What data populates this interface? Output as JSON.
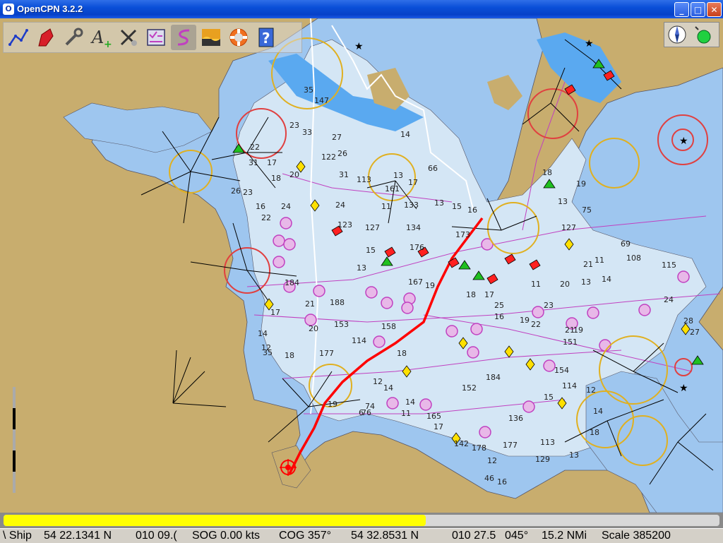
{
  "window": {
    "title": "OpenCPN 3.2.2",
    "icon": "opencpn-app-icon",
    "buttons": {
      "minimize": "_",
      "maximize": "□",
      "close": "✕"
    }
  },
  "toolbar": {
    "items": [
      {
        "name": "route-tool-button",
        "icon": "route-icon"
      },
      {
        "name": "ownship-button",
        "icon": "boat-icon"
      },
      {
        "name": "tools-button",
        "icon": "wrench-icon"
      },
      {
        "name": "text-button",
        "icon": "text-plus-icon"
      },
      {
        "name": "chart-quilt-button",
        "icon": "cross-icon"
      },
      {
        "name": "route-manager-button",
        "icon": "checklist-icon"
      },
      {
        "name": "track-button",
        "icon": "track-icon",
        "active": true
      },
      {
        "name": "tide-button",
        "icon": "tide-icon"
      },
      {
        "name": "mob-button",
        "icon": "lifebuoy-icon"
      },
      {
        "name": "help-button",
        "icon": "help-icon"
      }
    ]
  },
  "progress": {
    "value": 0.59
  },
  "colors": {
    "land": "#c8ad6e",
    "shallow": "#9ec6ef",
    "deep": "#d4e6f5",
    "water": "#5aa9f0",
    "track": "#ff0000",
    "magenta": "#c040c0",
    "progress": "#ffff00"
  },
  "status": {
    "ship_label": "\\ Ship",
    "ship_lat": "54 22.1341 N",
    "ship_lon": "010 09.(",
    "sog": "SOG 0.00 kts",
    "cog": "COG 357°",
    "cursor_lat": "54 32.8531 N",
    "cursor_lon": "010 27.5",
    "cursor_brg": "045°",
    "cursor_dist": "15.2 NMi",
    "scale": "Scale 385200"
  },
  "chart": {
    "soundings": [
      [
        "35",
        430,
        105
      ],
      [
        "147",
        445,
        120
      ],
      [
        "33",
        428,
        165
      ],
      [
        "27",
        470,
        172
      ],
      [
        "26",
        478,
        195
      ],
      [
        "122",
        455,
        200
      ],
      [
        "31",
        480,
        225
      ],
      [
        "113",
        505,
        232
      ],
      [
        "24",
        475,
        268
      ],
      [
        "123",
        478,
        296
      ],
      [
        "127",
        517,
        300
      ],
      [
        "15",
        518,
        332
      ],
      [
        "13",
        505,
        357
      ],
      [
        "176",
        580,
        328
      ],
      [
        "167",
        578,
        377
      ],
      [
        "19",
        602,
        382
      ],
      [
        "173",
        645,
        310
      ],
      [
        "16",
        662,
        275
      ],
      [
        "15",
        640,
        270
      ],
      [
        "13",
        615,
        265
      ],
      [
        "11",
        540,
        270
      ],
      [
        "133",
        572,
        268
      ],
      [
        "134",
        575,
        300
      ],
      [
        "24",
        398,
        270
      ],
      [
        "22",
        370,
        286
      ],
      [
        "184",
        403,
        378
      ],
      [
        "21",
        432,
        408
      ],
      [
        "188",
        467,
        406
      ],
      [
        "20",
        437,
        443
      ],
      [
        "153",
        473,
        437
      ],
      [
        "158",
        540,
        440
      ],
      [
        "114",
        498,
        460
      ],
      [
        "18",
        562,
        478
      ],
      [
        "177",
        452,
        478
      ],
      [
        "12",
        528,
        518
      ],
      [
        "14",
        543,
        527
      ],
      [
        "11",
        568,
        563
      ],
      [
        "165",
        604,
        567
      ],
      [
        "17",
        614,
        582
      ],
      [
        "142",
        643,
        606
      ],
      [
        "136",
        720,
        570
      ],
      [
        "177",
        712,
        608
      ],
      [
        "178",
        668,
        612
      ],
      [
        "12",
        690,
        630
      ],
      [
        "16",
        704,
        660
      ],
      [
        "46",
        686,
        655
      ],
      [
        "113",
        765,
        604
      ],
      [
        "13",
        806,
        622
      ],
      [
        "129",
        758,
        628
      ],
      [
        "154",
        785,
        502
      ],
      [
        "114",
        796,
        524
      ],
      [
        "15",
        770,
        540
      ],
      [
        "18",
        660,
        395
      ],
      [
        "17",
        686,
        395
      ],
      [
        "16",
        700,
        426
      ],
      [
        "23",
        770,
        410
      ],
      [
        "22",
        752,
        437
      ],
      [
        "19",
        736,
        431
      ],
      [
        "21",
        800,
        445
      ],
      [
        "151",
        797,
        462
      ],
      [
        "20",
        793,
        380
      ],
      [
        "11",
        752,
        380
      ],
      [
        "13",
        823,
        377
      ],
      [
        "21",
        826,
        352
      ],
      [
        "11",
        842,
        346
      ],
      [
        "14",
        852,
        373
      ],
      [
        "108",
        887,
        343
      ],
      [
        "115",
        937,
        353
      ],
      [
        "69",
        879,
        323
      ],
      [
        "127",
        795,
        300
      ],
      [
        "75",
        824,
        275
      ],
      [
        "13",
        790,
        263
      ],
      [
        "18",
        768,
        222
      ],
      [
        "19",
        816,
        238
      ],
      [
        "17",
        383,
        420
      ],
      [
        "14",
        365,
        450
      ],
      [
        "12",
        370,
        470
      ],
      [
        "35",
        372,
        477
      ],
      [
        "18",
        403,
        481
      ],
      [
        "19",
        464,
        550
      ],
      [
        "76",
        512,
        562
      ],
      [
        "6",
        508,
        562
      ],
      [
        "74",
        517,
        553
      ],
      [
        "25",
        700,
        410
      ],
      [
        "14",
        574,
        547
      ],
      [
        "184",
        688,
        512
      ],
      [
        "152",
        654,
        527
      ],
      [
        "17",
        378,
        208
      ],
      [
        "18",
        384,
        230
      ],
      [
        "26",
        327,
        248
      ],
      [
        "23",
        344,
        250
      ],
      [
        "16",
        362,
        270
      ],
      [
        "161",
        545,
        245
      ],
      [
        "17",
        578,
        236
      ],
      [
        "66",
        606,
        216
      ],
      [
        "14",
        567,
        168
      ],
      [
        "13",
        557,
        226
      ],
      [
        "23",
        410,
        155
      ],
      [
        "22",
        354,
        186
      ],
      [
        "31",
        352,
        208
      ],
      [
        "20",
        410,
        225
      ],
      [
        "19",
        812,
        445
      ],
      [
        "28",
        968,
        432
      ],
      [
        "27",
        977,
        448
      ],
      [
        "24",
        940,
        402
      ],
      [
        "18",
        835,
        590
      ],
      [
        "12",
        830,
        530
      ],
      [
        "14",
        840,
        560
      ]
    ],
    "place_labels": []
  }
}
